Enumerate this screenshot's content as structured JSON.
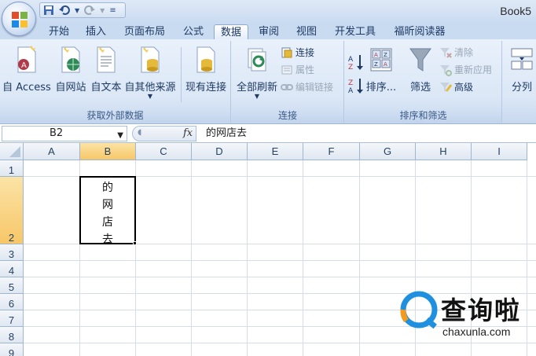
{
  "window": {
    "title": "Book5"
  },
  "tabs": [
    "开始",
    "插入",
    "页面布局",
    "公式",
    "数据",
    "审阅",
    "视图",
    "开发工具",
    "福昕阅读器"
  ],
  "active_tab": "数据",
  "ribbon": {
    "external": {
      "label": "获取外部数据",
      "buttons": [
        "自 Access",
        "自网站",
        "自文本",
        "自其他来源",
        "现有连接"
      ]
    },
    "connections": {
      "label": "连接",
      "refresh": "全部刷新",
      "items": [
        "连接",
        "属性",
        "编辑链接"
      ]
    },
    "sort_filter": {
      "label": "排序和筛选",
      "sort": "排序...",
      "filter": "筛选",
      "items": [
        "清除",
        "重新应用",
        "高级"
      ]
    },
    "data_tools": {
      "split": "分列"
    }
  },
  "formula_bar": {
    "name_box": "B2",
    "fx": "fx",
    "content": "的网店去"
  },
  "grid": {
    "columns": [
      "A",
      "B",
      "C",
      "D",
      "E",
      "F",
      "G",
      "H",
      "I"
    ],
    "rows": [
      "1",
      "2",
      "3",
      "4",
      "5",
      "6",
      "7",
      "8",
      "9"
    ],
    "selected_col": "B",
    "selected_row": "2",
    "cell_b2_lines": [
      "的",
      "网",
      "店",
      "去"
    ]
  },
  "watermark": {
    "brand": "查询啦",
    "domain": "chaxunla.com"
  },
  "colors": {
    "ribbon": "#dbe7f6",
    "selection_header": "#f7c768",
    "accent": "#1f3a63"
  }
}
